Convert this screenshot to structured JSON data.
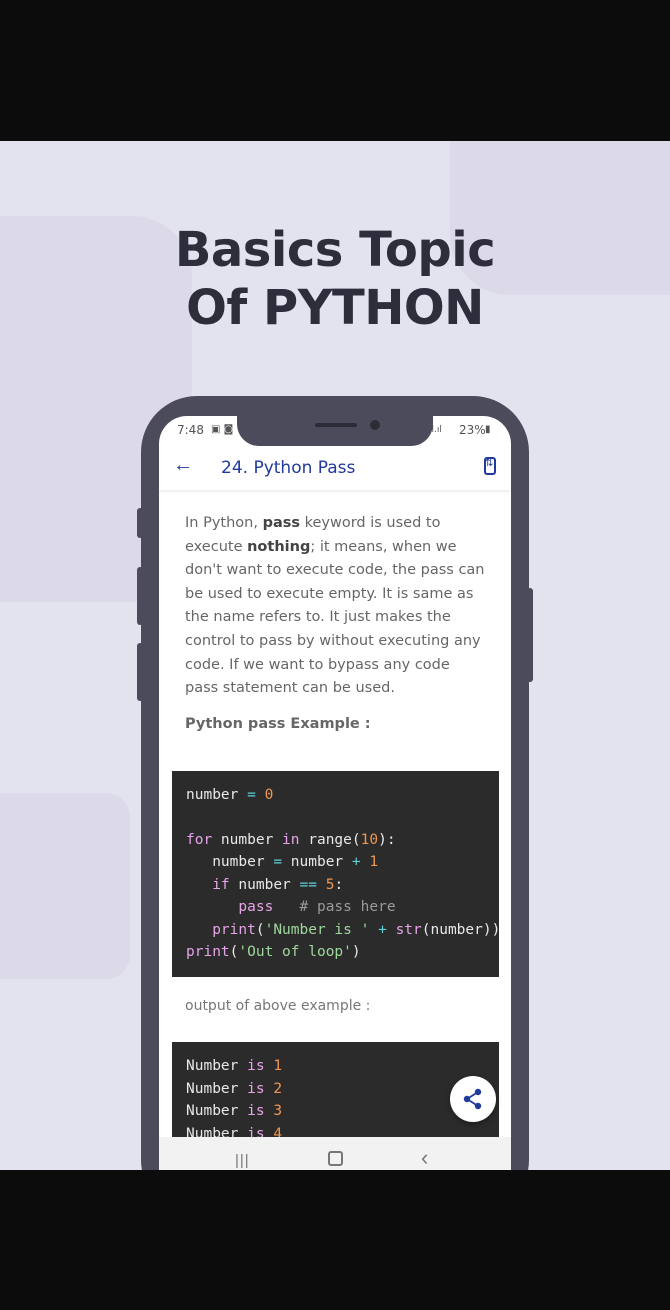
{
  "banner": {
    "headline_line1": "Basics Topic",
    "headline_line2": "Of PYTHON"
  },
  "status_bar": {
    "time": "7:48",
    "battery": "23%"
  },
  "app_bar": {
    "title": "24. Python Pass"
  },
  "content": {
    "para": {
      "t1": "In Python, ",
      "b1": "pass",
      "t2": " keyword is used to execute ",
      "b2": "nothing",
      "t3": "; it means, when we don't want to execute code, the pass can be used to execute empty. It is same as the name refers to. It just makes the control to pass by without executing any code. If we want to bypass any code pass statement can be used."
    },
    "example_heading": "Python pass Example :",
    "code_example": [
      "number = 0",
      "",
      "for number in range(10):",
      "   number = number + 1",
      "   if number == 5:",
      "      pass   # pass here",
      "   print('Number is ' + str(number))",
      "print('Out of loop')"
    ],
    "output_label": "output of above example  :",
    "output_lines": [
      "Number is 1",
      "Number is 2",
      "Number is 3",
      "Number is 4"
    ]
  },
  "icons": {
    "back": "arrow-left-icon",
    "rotate": "screen-rotation-icon",
    "share": "share-icon"
  }
}
